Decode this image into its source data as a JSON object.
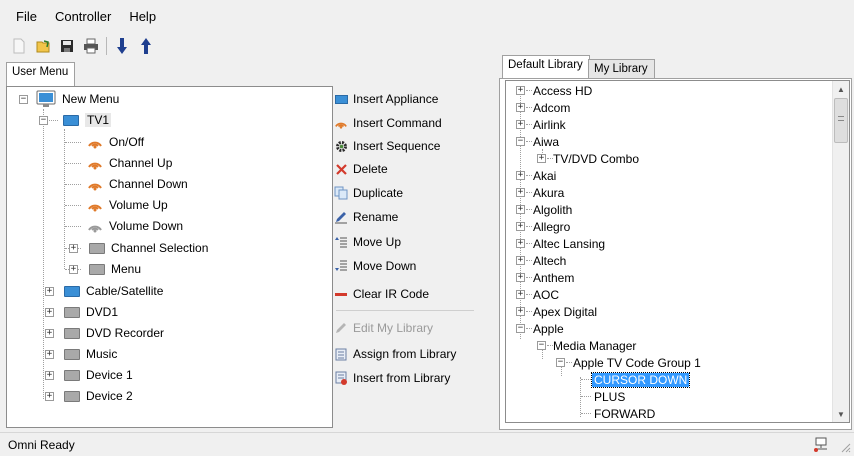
{
  "menu": {
    "file": "File",
    "controller": "Controller",
    "help": "Help"
  },
  "toolbar": {
    "buttons": [
      {
        "icon": "new-icon"
      },
      {
        "icon": "open-icon"
      },
      {
        "icon": "save-icon"
      },
      {
        "icon": "print-icon"
      },
      {
        "icon": "download-icon"
      },
      {
        "icon": "upload-icon"
      }
    ]
  },
  "left_tabs": {
    "user_menu": "User Menu"
  },
  "left_tree": {
    "root": "New Menu",
    "tv": "TV1",
    "tv_children": [
      "On/Off",
      "Channel Up",
      "Channel Down",
      "Volume Up",
      "Volume Down"
    ],
    "tv_groups": [
      "Channel Selection",
      "Menu"
    ],
    "others": [
      "Cable/Satellite",
      "DVD1",
      "DVD Recorder",
      "Music",
      "Device 1",
      "Device 2"
    ]
  },
  "actions": {
    "insert_appliance": "Insert Appliance",
    "insert_command": "Insert Command",
    "insert_sequence": "Insert Sequence",
    "delete": "Delete",
    "duplicate": "Duplicate",
    "rename": "Rename",
    "move_up": "Move Up",
    "move_down": "Move Down",
    "clear_ir": "Clear IR Code",
    "edit_library": "Edit My Library",
    "assign_library": "Assign from Library",
    "insert_library": "Insert from Library"
  },
  "right_tabs": {
    "default": "Default Library",
    "mine": "My Library"
  },
  "library": {
    "brands_before": [
      "Access HD",
      "Adcom",
      "Airlink"
    ],
    "aiwa": "Aiwa",
    "aiwa_child": "TV/DVD Combo",
    "brands_mid": [
      "Akai",
      "Akura",
      "Algolith",
      "Allegro",
      "Altec Lansing",
      "Altech",
      "Anthem",
      "AOC",
      "Apex Digital"
    ],
    "apple": "Apple",
    "media_manager": "Media Manager",
    "code_group": "Apple TV Code Group 1",
    "codes": [
      "CURSOR DOWN",
      "PLUS",
      "FORWARD"
    ]
  },
  "status": {
    "text": "Omni Ready",
    "icon": "network-icon"
  },
  "colors": {
    "remote_orange": "#e07a2a",
    "monitor_blue": "#3a8fd6",
    "selection": "#3399ff",
    "delete_red": "#d33a2c"
  }
}
